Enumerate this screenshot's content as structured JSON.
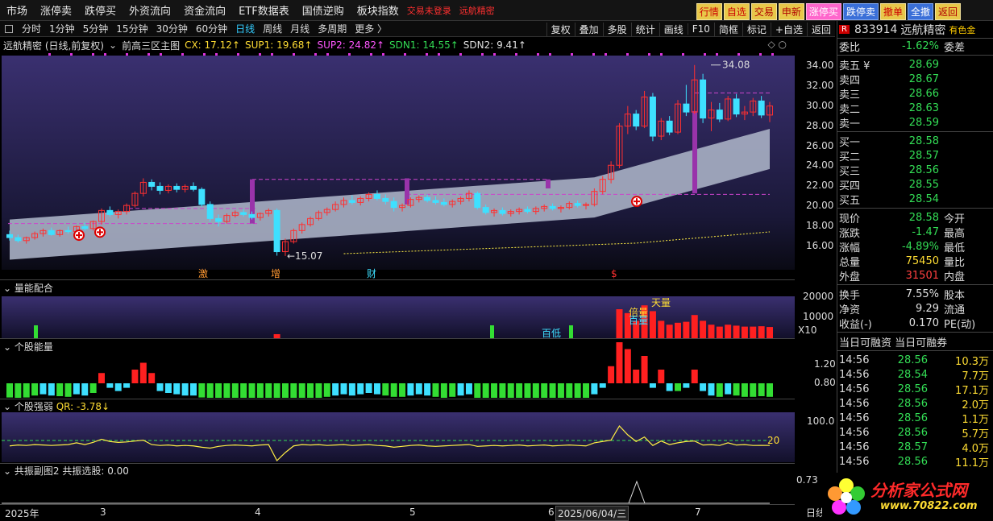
{
  "menu": [
    "市场",
    "涨停卖",
    "跌停买",
    "外资流向",
    "资金流向",
    "ETF数据表",
    "国债逆购",
    "板块指数"
  ],
  "menu_notice": "交易未登录",
  "menu_stock": "远航精密",
  "top_buttons": [
    {
      "label": "行情",
      "style": "yellow"
    },
    {
      "label": "自选",
      "style": "yellow"
    },
    {
      "label": "交易",
      "style": "red"
    },
    {
      "label": "申新",
      "style": "red"
    },
    {
      "label": "涨停买",
      "style": "pink"
    },
    {
      "label": "跌停卖",
      "style": "blue"
    },
    {
      "label": "撤单",
      "style": "yellow"
    },
    {
      "label": "全撤",
      "style": "blue"
    },
    {
      "label": "返回",
      "style": "red"
    }
  ],
  "periods": [
    "分时",
    "1分钟",
    "5分钟",
    "15分钟",
    "30分钟",
    "60分钟",
    "日线",
    "周线",
    "月线",
    "多周期",
    "更多 〉"
  ],
  "active_period": "日线",
  "right_tools": [
    "复权",
    "叠加",
    "多股",
    "统计",
    "画线",
    "F10",
    "简框",
    "标记",
    "+自选",
    "返回"
  ],
  "main_header": {
    "title": "远航精密 (日线,前复权)",
    "indicator": "前高三区主图",
    "cx": "CX: 17.12↑",
    "sup1": "SUP1: 19.68↑",
    "sup2": "SUP2: 24.82↑",
    "sdn1": "SDN1: 14.55↑",
    "sdn2": "SDN2: 9.41↑"
  },
  "price_axis": [
    "34.00",
    "32.00",
    "30.00",
    "28.00",
    "26.00",
    "24.00",
    "22.00",
    "20.00",
    "18.00",
    "16.00"
  ],
  "annotations": {
    "high": "34.08",
    "low": "15.07"
  },
  "markers": [
    "激",
    "增",
    "财",
    "$"
  ],
  "vol_panel": {
    "title": "量能配合",
    "axis": [
      "20000",
      "10000"
    ],
    "unit": "X10",
    "labels": [
      "百低",
      "天量",
      "倍量",
      "百量"
    ]
  },
  "energy_panel": {
    "title": "个股能量",
    "axis": [
      "1.20",
      "0.80"
    ]
  },
  "strength_panel": {
    "title": "个股强弱",
    "qr": "QR: -3.78↓",
    "axis": [
      "100.0"
    ],
    "level": "20"
  },
  "resonance_panel": {
    "title": "共振副图2",
    "value": "共振选股: 0.00",
    "axis": "0.73"
  },
  "dates": [
    "2025年",
    "3",
    "4",
    "5",
    "6",
    "2025/06/04/三",
    "7"
  ],
  "date_right": "日线",
  "quote": {
    "code": "833914",
    "name": "远航精密",
    "industry": "有色金",
    "weibi": {
      "label": "委比",
      "value": "-1.62%",
      "label2": "委差"
    },
    "sell": [
      {
        "label": "卖五 ¥",
        "price": "28.69"
      },
      {
        "label": "卖四",
        "price": "28.67"
      },
      {
        "label": "卖三",
        "price": "28.66"
      },
      {
        "label": "卖二",
        "price": "28.63"
      },
      {
        "label": "卖一",
        "price": "28.59"
      }
    ],
    "buy": [
      {
        "label": "买一",
        "price": "28.58"
      },
      {
        "label": "买二",
        "price": "28.57"
      },
      {
        "label": "买三",
        "price": "28.56"
      },
      {
        "label": "买四",
        "price": "28.55"
      },
      {
        "label": "买五",
        "price": "28.54"
      }
    ],
    "stats": [
      {
        "l": "现价",
        "v": "28.58",
        "c": "grn",
        "l2": "今开"
      },
      {
        "l": "涨跌",
        "v": "-1.47",
        "c": "grn",
        "l2": "最高"
      },
      {
        "l": "涨幅",
        "v": "-4.89%",
        "c": "grn",
        "l2": "最低"
      },
      {
        "l": "总量",
        "v": "75450",
        "c": "ylw",
        "l2": "量比"
      },
      {
        "l": "外盘",
        "v": "31501",
        "c": "red",
        "l2": "内盘"
      }
    ],
    "stats2": [
      {
        "l": "换手",
        "v": "7.55%",
        "c": "wht",
        "l2": "股本"
      },
      {
        "l": "净资",
        "v": "9.29",
        "c": "wht",
        "l2": "流通"
      },
      {
        "l": "收益(-)",
        "v": "0.170",
        "c": "wht",
        "l2": "PE(动)"
      }
    ],
    "finance_hdr": "当日可融资 当日可融券",
    "ticks": [
      {
        "t": "14:56",
        "p": "28.56",
        "q": "10.3万"
      },
      {
        "t": "14:56",
        "p": "28.54",
        "q": "7.7万"
      },
      {
        "t": "14:56",
        "p": "28.56",
        "q": "17.1万"
      },
      {
        "t": "14:56",
        "p": "28.56",
        "q": "2.0万"
      },
      {
        "t": "14:56",
        "p": "28.56",
        "q": "1.1万"
      },
      {
        "t": "14:56",
        "p": "28.56",
        "q": "5.7万"
      },
      {
        "t": "14:56",
        "p": "28.57",
        "q": "4.0万"
      },
      {
        "t": "14:56",
        "p": "28.56",
        "q": "11.1万"
      }
    ]
  },
  "logo": {
    "text": "分析家公式网",
    "url": "www.70822.com"
  },
  "colors": {
    "up": "#ff3030",
    "down": "#33dd55",
    "cyan": "#3ee0ff",
    "magenta": "#cc33cc",
    "bg_chart": "#2a2555"
  },
  "chart_data": {
    "type": "candlestick",
    "ylim": [
      15,
      35
    ],
    "ohlc": [
      [
        17.2,
        17.6,
        16.6,
        16.9
      ],
      [
        16.9,
        17.2,
        16.4,
        16.6
      ],
      [
        16.6,
        17.0,
        16.3,
        16.9
      ],
      [
        16.9,
        17.5,
        16.7,
        17.3
      ],
      [
        17.3,
        17.8,
        17.0,
        17.6
      ],
      [
        17.6,
        17.9,
        17.1,
        17.2
      ],
      [
        17.2,
        17.7,
        17.0,
        17.6
      ],
      [
        17.6,
        18.0,
        17.3,
        17.5
      ],
      [
        17.5,
        18.1,
        17.2,
        18.0
      ],
      [
        18.0,
        18.4,
        17.6,
        17.8
      ],
      [
        17.8,
        18.6,
        17.6,
        18.5
      ],
      [
        18.5,
        19.8,
        18.2,
        19.6
      ],
      [
        19.6,
        20.0,
        19.0,
        19.2
      ],
      [
        19.2,
        19.7,
        18.8,
        19.5
      ],
      [
        19.5,
        20.3,
        19.2,
        20.1
      ],
      [
        20.1,
        21.5,
        19.9,
        21.3
      ],
      [
        21.3,
        22.8,
        21.0,
        22.4
      ],
      [
        22.4,
        22.7,
        21.6,
        22.0
      ],
      [
        22.0,
        22.4,
        21.2,
        21.6
      ],
      [
        21.6,
        22.2,
        21.3,
        22.0
      ],
      [
        22.0,
        22.3,
        21.4,
        21.7
      ],
      [
        21.7,
        22.2,
        21.4,
        22.0
      ],
      [
        22.0,
        22.4,
        21.5,
        21.7
      ],
      [
        21.7,
        21.9,
        20.0,
        20.2
      ],
      [
        20.2,
        20.5,
        18.5,
        18.8
      ],
      [
        18.8,
        19.2,
        18.0,
        18.5
      ],
      [
        18.5,
        19.3,
        18.3,
        19.1
      ],
      [
        19.1,
        19.6,
        18.9,
        19.4
      ],
      [
        19.4,
        19.7,
        19.0,
        19.2
      ],
      [
        19.2,
        19.5,
        18.7,
        18.9
      ],
      [
        18.9,
        19.4,
        18.6,
        19.3
      ],
      [
        19.3,
        19.8,
        19.0,
        19.6
      ],
      [
        19.6,
        19.8,
        15.1,
        15.5
      ],
      [
        15.5,
        16.8,
        15.07,
        16.5
      ],
      [
        16.5,
        17.8,
        16.3,
        17.6
      ],
      [
        17.6,
        18.4,
        17.3,
        18.2
      ],
      [
        18.2,
        19.0,
        18.0,
        18.8
      ],
      [
        18.8,
        19.6,
        18.6,
        19.4
      ],
      [
        19.4,
        19.9,
        19.1,
        19.7
      ],
      [
        19.7,
        20.5,
        19.5,
        20.2
      ],
      [
        20.2,
        20.9,
        19.9,
        20.6
      ],
      [
        20.6,
        21.1,
        20.2,
        20.4
      ],
      [
        20.4,
        21.0,
        20.1,
        20.8
      ],
      [
        20.8,
        21.4,
        20.5,
        21.2
      ],
      [
        21.2,
        21.6,
        20.6,
        20.8
      ],
      [
        20.8,
        21.2,
        20.2,
        20.5
      ],
      [
        20.5,
        20.9,
        19.5,
        19.9
      ],
      [
        19.9,
        20.3,
        19.5,
        20.1
      ],
      [
        20.1,
        20.9,
        19.9,
        20.7
      ],
      [
        20.7,
        21.1,
        20.4,
        20.9
      ],
      [
        20.9,
        21.2,
        20.4,
        20.6
      ],
      [
        20.6,
        21.0,
        20.2,
        20.4
      ],
      [
        20.4,
        20.8,
        20.0,
        20.2
      ],
      [
        20.2,
        20.7,
        19.9,
        20.5
      ],
      [
        20.5,
        21.0,
        20.2,
        20.8
      ],
      [
        20.8,
        21.6,
        20.5,
        21.3
      ],
      [
        21.3,
        21.5,
        19.7,
        19.9
      ],
      [
        19.9,
        20.2,
        19.2,
        19.4
      ],
      [
        19.4,
        19.8,
        19.0,
        19.6
      ],
      [
        19.6,
        19.9,
        19.1,
        19.3
      ],
      [
        19.3,
        19.7,
        19.0,
        19.5
      ],
      [
        19.5,
        19.9,
        19.2,
        19.7
      ],
      [
        19.7,
        20.0,
        19.3,
        19.5
      ],
      [
        19.5,
        20.0,
        19.2,
        19.8
      ],
      [
        19.8,
        20.2,
        19.5,
        20.0
      ],
      [
        20.0,
        20.3,
        19.6,
        19.8
      ],
      [
        19.8,
        20.1,
        19.4,
        19.9
      ],
      [
        19.9,
        20.5,
        19.7,
        20.3
      ],
      [
        20.3,
        20.6,
        19.9,
        20.1
      ],
      [
        20.1,
        20.4,
        19.7,
        20.2
      ],
      [
        20.2,
        21.8,
        20.0,
        21.5
      ],
      [
        21.5,
        23.0,
        21.2,
        22.7
      ],
      [
        22.7,
        24.5,
        22.3,
        24.1
      ],
      [
        24.1,
        28.3,
        23.8,
        28.0
      ],
      [
        28.0,
        30.0,
        27.2,
        29.2
      ],
      [
        29.2,
        29.6,
        27.6,
        28.0
      ],
      [
        28.0,
        31.5,
        27.8,
        30.9
      ],
      [
        30.9,
        31.3,
        26.5,
        27.0
      ],
      [
        27.0,
        28.8,
        26.6,
        28.5
      ],
      [
        28.5,
        29.0,
        27.1,
        27.4
      ],
      [
        27.4,
        30.6,
        27.2,
        30.2
      ],
      [
        30.2,
        32.1,
        29.0,
        29.4
      ],
      [
        29.4,
        34.08,
        29.2,
        32.6
      ],
      [
        32.6,
        33.2,
        28.3,
        28.8
      ],
      [
        28.8,
        30.4,
        27.5,
        29.6
      ],
      [
        29.6,
        30.3,
        28.4,
        28.7
      ],
      [
        28.7,
        31.0,
        28.5,
        30.7
      ],
      [
        30.7,
        31.2,
        28.9,
        29.2
      ],
      [
        29.2,
        30.0,
        28.6,
        29.4
      ],
      [
        29.4,
        30.8,
        29.0,
        30.5
      ],
      [
        30.5,
        31.0,
        28.8,
        29.1
      ],
      [
        29.1,
        30.4,
        28.4,
        30.0
      ]
    ],
    "cx": 17.12,
    "sup1": 19.68,
    "sup2": 24.82,
    "sdn1": 14.55,
    "sdn2": 9.41,
    "volume_k": [
      40,
      30,
      30,
      35,
      40,
      38,
      35,
      35,
      45,
      40,
      50,
      90,
      70,
      60,
      75,
      100,
      140,
      90,
      70,
      65,
      55,
      50,
      55,
      80,
      120,
      90,
      70,
      60,
      50,
      50,
      55,
      60,
      210,
      160,
      120,
      90,
      70,
      60,
      55,
      60,
      65,
      55,
      60,
      65,
      55,
      50,
      70,
      55,
      60,
      55,
      50,
      45,
      45,
      50,
      55,
      70,
      80,
      60,
      50,
      45,
      45,
      50,
      45,
      50,
      55,
      50,
      45,
      55,
      50,
      50,
      90,
      140,
      200,
      1500,
      1300,
      900,
      1700,
      1400,
      900,
      700,
      800,
      850,
      1200,
      900,
      700,
      600,
      700,
      650,
      600,
      600,
      620,
      580
    ],
    "energy": [
      0.75,
      0.73,
      0.75,
      0.78,
      0.8,
      0.78,
      0.77,
      0.76,
      0.8,
      0.78,
      0.82,
      0.95,
      0.9,
      0.85,
      0.9,
      1.0,
      1.1,
      0.95,
      0.85,
      0.82,
      0.8,
      0.78,
      0.78,
      0.75,
      0.7,
      0.68,
      0.72,
      0.74,
      0.72,
      0.7,
      0.72,
      0.74,
      0.6,
      0.62,
      0.66,
      0.7,
      0.72,
      0.74,
      0.76,
      0.78,
      0.8,
      0.78,
      0.8,
      0.82,
      0.8,
      0.78,
      0.76,
      0.76,
      0.78,
      0.8,
      0.78,
      0.76,
      0.74,
      0.76,
      0.78,
      0.8,
      0.74,
      0.7,
      0.7,
      0.68,
      0.7,
      0.72,
      0.7,
      0.72,
      0.74,
      0.72,
      0.7,
      0.72,
      0.72,
      0.72,
      0.8,
      0.9,
      1.05,
      1.4,
      1.3,
      1.0,
      1.2,
      0.9,
      1.0,
      0.85,
      0.85,
      0.9,
      1.0,
      0.85,
      0.78,
      0.76,
      0.8,
      0.78,
      0.76,
      0.76,
      0.77,
      0.76
    ],
    "qr": [
      -5,
      -3,
      -4,
      -2,
      -3,
      -4,
      -3,
      -2,
      2,
      -2,
      3,
      10,
      5,
      3,
      4,
      6,
      8,
      -2,
      -4,
      -3,
      -5,
      -4,
      -5,
      -8,
      -10,
      -6,
      -4,
      -3,
      -4,
      -5,
      -3,
      -2,
      -40,
      -20,
      -5,
      -2,
      -3,
      -2,
      -4,
      -3,
      -2,
      -4,
      -3,
      -2,
      -4,
      -5,
      -8,
      -6,
      -4,
      -3,
      -5,
      -6,
      -5,
      -4,
      -3,
      -2,
      -6,
      -5,
      -4,
      -5,
      -4,
      -3,
      -5,
      -4,
      -3,
      -5,
      -4,
      -3,
      -4,
      -5,
      2,
      5,
      8,
      40,
      20,
      5,
      15,
      -4,
      6,
      -2,
      2,
      5,
      6,
      -3,
      -2,
      -4,
      2,
      -3,
      -2,
      -4,
      -3.78,
      -4
    ]
  }
}
